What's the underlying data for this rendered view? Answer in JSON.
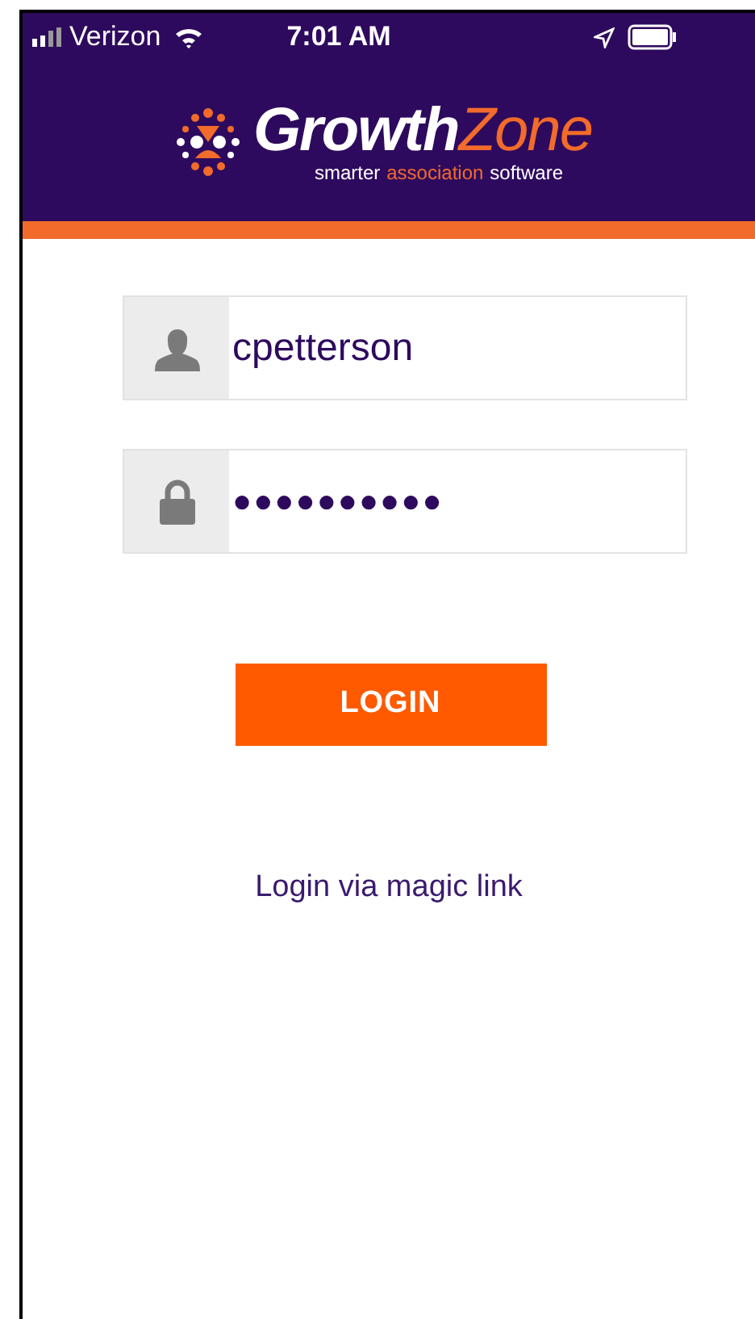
{
  "status_bar": {
    "carrier": "Verizon",
    "time": "7:01 AM"
  },
  "header": {
    "logo_growth": "Growth",
    "logo_zone": "Zone",
    "tagline": [
      {
        "text": "smarter",
        "accent": false
      },
      {
        "text": "association",
        "accent": true
      },
      {
        "text": "software",
        "accent": false
      }
    ]
  },
  "fields": [
    {
      "kind": "user",
      "value": "cpetterson"
    },
    {
      "kind": "lock",
      "value": "●●●●●●●●●●"
    }
  ],
  "login_button": "LOGIN",
  "magic_link": "Login via magic link"
}
